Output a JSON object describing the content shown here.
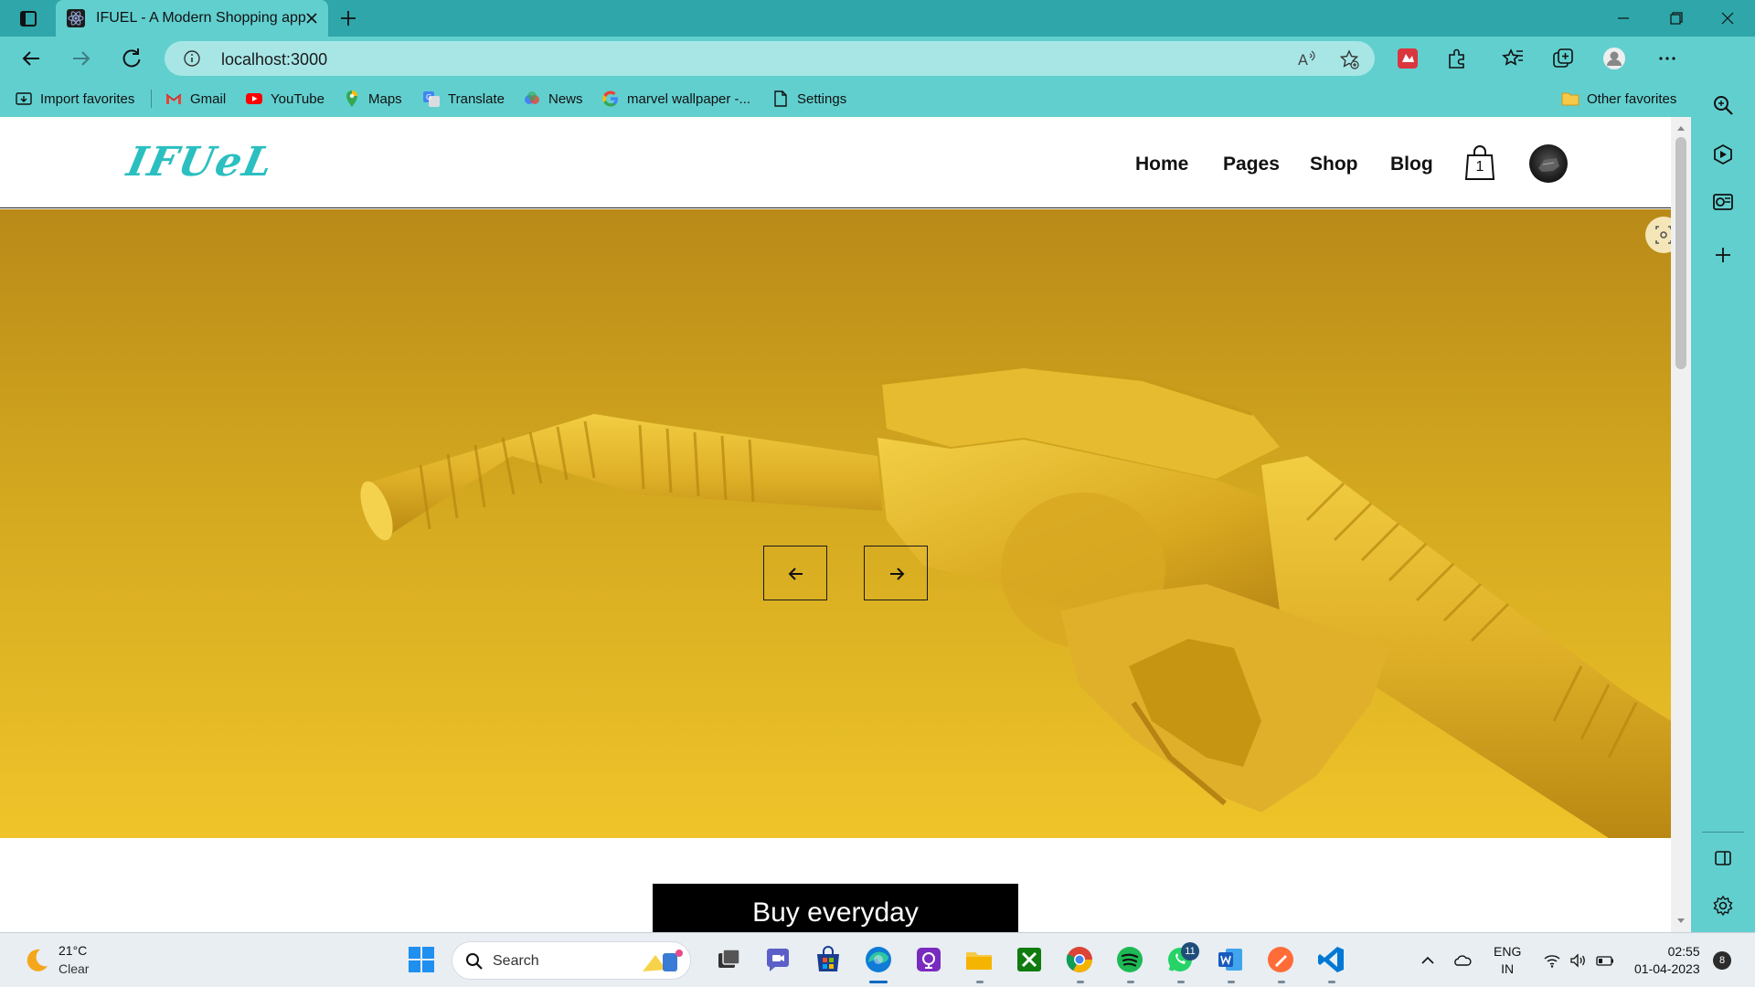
{
  "browser": {
    "tab_title": "IFUEL - A Modern Shopping app",
    "url": "localhost:3000"
  },
  "favorites": {
    "items": [
      {
        "label": "Import favorites",
        "icon": "import-icon"
      },
      {
        "label": "Gmail",
        "icon": "gmail-icon"
      },
      {
        "label": "YouTube",
        "icon": "youtube-icon"
      },
      {
        "label": "Maps",
        "icon": "maps-icon"
      },
      {
        "label": "Translate",
        "icon": "translate-icon"
      },
      {
        "label": "News",
        "icon": "news-icon"
      },
      {
        "label": "marvel wallpaper -...",
        "icon": "google-icon"
      },
      {
        "label": "Settings",
        "icon": "page-icon"
      }
    ],
    "other": "Other favorites"
  },
  "site": {
    "logo": "IFUeL",
    "nav": [
      "Home",
      "Pages",
      "Shop",
      "Blog"
    ],
    "cart_count": "1",
    "banner": "Buy everyday",
    "brand_color": "#2bbfc0"
  },
  "taskbar": {
    "weather_temp": "21°C",
    "weather_cond": "Clear",
    "search_placeholder": "Search",
    "whatsapp_badge": "11",
    "lang_top": "ENG",
    "lang_bottom": "IN",
    "time": "02:55",
    "date": "01-04-2023",
    "notifications": "8"
  }
}
